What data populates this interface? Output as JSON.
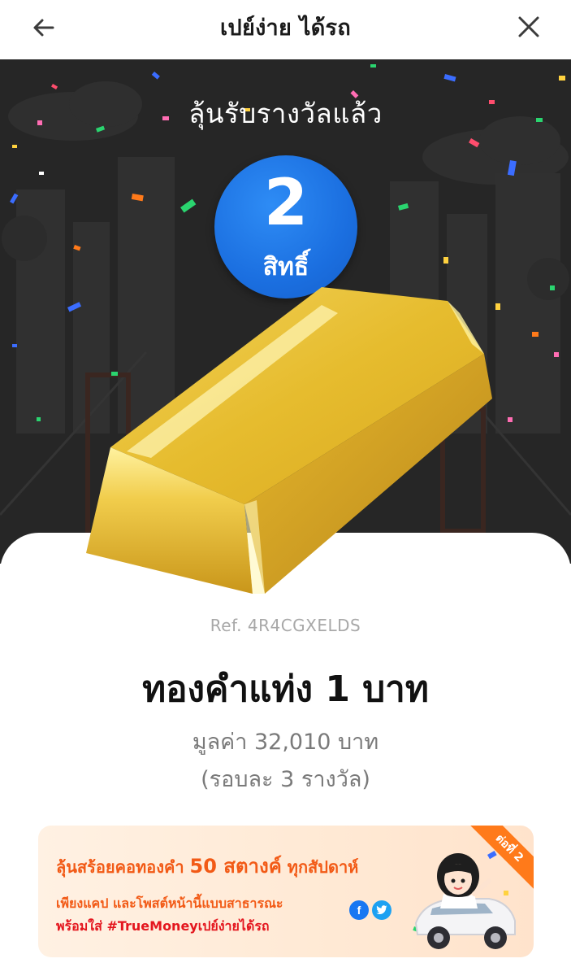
{
  "header": {
    "title": "เปย์ง่าย ได้รถ",
    "back_icon": "arrow-left-icon",
    "close_icon": "close-icon"
  },
  "hero": {
    "title": "ลุ้นรับรางวัลแล้ว",
    "badge": {
      "count": "2",
      "label": "สิทธิ์"
    },
    "badge_color": "#1b6fe0",
    "background_color": "#262626"
  },
  "prize": {
    "ref": "Ref. 4R4CGXELDS",
    "name": "ทองคำแท่ง 1 บาท",
    "value": "มูลค่า 32,010 บาท",
    "round": "(รอบละ 3 รางวัล)",
    "image": "gold-bar"
  },
  "promo": {
    "line1_pre": "ลุ้นสร้อยคอทองคำ",
    "line1_highlight": "50 สตางค์",
    "line1_post": "ทุกสัปดาห์",
    "line2": "เพียงแคป และโพสต์หน้านี้แบบสาธารณะ",
    "line3": "พร้อมใส่ #TrueMoneyเปย์ง่ายได้รถ",
    "ribbon": "ต่อที่ 2",
    "accent_color": "#f25a16",
    "social": [
      "facebook-icon",
      "twitter-icon"
    ]
  }
}
